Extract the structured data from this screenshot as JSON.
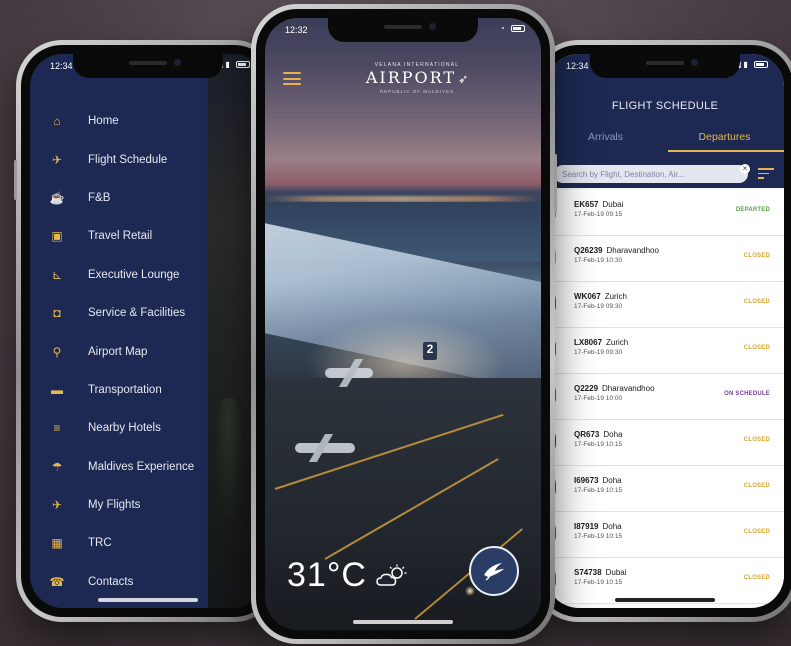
{
  "left_phone": {
    "status_time": "12:34",
    "menu": [
      {
        "label": "Home",
        "icon": "home-icon",
        "glyph": "⌂"
      },
      {
        "label": "Flight Schedule",
        "icon": "plane-icon",
        "glyph": "✈"
      },
      {
        "label": "F&B",
        "icon": "food-icon",
        "glyph": "☕"
      },
      {
        "label": "Travel Retail",
        "icon": "bag-icon",
        "glyph": "▣"
      },
      {
        "label": "Executive Lounge",
        "icon": "lounge-chair-icon",
        "glyph": "⊾"
      },
      {
        "label": "Service & Facilities",
        "icon": "service-icon",
        "glyph": "◘"
      },
      {
        "label": "Airport Map",
        "icon": "map-pin-icon",
        "glyph": "⚲"
      },
      {
        "label": "Transportation",
        "icon": "bus-icon",
        "glyph": "▬"
      },
      {
        "label": "Nearby Hotels",
        "icon": "bed-icon",
        "glyph": "≡"
      },
      {
        "label": "Maldives Experience",
        "icon": "palm-icon",
        "glyph": "☂"
      },
      {
        "label": "My Flights",
        "icon": "plane-takeoff-icon",
        "glyph": "✈"
      },
      {
        "label": "TRC",
        "icon": "calendar-icon",
        "glyph": "▦"
      },
      {
        "label": "Contacts",
        "icon": "contacts-icon",
        "glyph": "☎"
      }
    ]
  },
  "center_phone": {
    "status_time": "12:32",
    "logo": {
      "top": "VELANA INTERNATIONAL",
      "main": "AIRPORT",
      "sub": "REPUBLIC OF MALDIVES"
    },
    "gate_number": "2",
    "temperature": "31°C",
    "weather_icon": "partly-cloudy-icon"
  },
  "right_phone": {
    "status_time": "12:34",
    "title": "FLIGHT SCHEDULE",
    "tabs": [
      {
        "label": "Arrivals",
        "active": false
      },
      {
        "label": "Departures",
        "active": true
      }
    ],
    "search_placeholder": "Search by Flight, Destination, Air...",
    "flights": [
      {
        "flight": "EK657",
        "dest": "Dubai",
        "date": "17-Feb-19 09:15",
        "status": "DEPARTED",
        "status_color": "green",
        "tail": "#5aa14a"
      },
      {
        "flight": "Q26239",
        "dest": "Dharavandhoo",
        "date": "17-Feb-19 10:30",
        "status": "CLOSED",
        "status_color": "gold",
        "tail": "#d9a62e"
      },
      {
        "flight": "WK067",
        "dest": "Zurich",
        "date": "17-Feb-19 09:30",
        "status": "CLOSED",
        "status_color": "gold",
        "tail": "#c0392b"
      },
      {
        "flight": "LX8067",
        "dest": "Zurich",
        "date": "17-Feb-19 09:30",
        "status": "CLOSED",
        "status_color": "gold",
        "tail": "#c0392b"
      },
      {
        "flight": "Q2229",
        "dest": "Dharavandhoo",
        "date": "17-Feb-19 10:00",
        "status": "ON SCHEDULE",
        "status_color": "purple",
        "tail": "#2a6fb0"
      },
      {
        "flight": "QR673",
        "dest": "Doha",
        "date": "17-Feb-19 10:15",
        "status": "CLOSED",
        "status_color": "gold",
        "tail": "#7a1f3d"
      },
      {
        "flight": "I69673",
        "dest": "Doha",
        "date": "17-Feb-19 10:15",
        "status": "CLOSED",
        "status_color": "gold",
        "tail": "#b02a2a"
      },
      {
        "flight": "I87919",
        "dest": "Doha",
        "date": "17-Feb-19 10:15",
        "status": "CLOSED",
        "status_color": "gold",
        "tail": "#c0392b"
      },
      {
        "flight": "S74738",
        "dest": "Dubai",
        "date": "17-Feb-19 10:15",
        "status": "CLOSED",
        "status_color": "gold",
        "tail": "#3a8a3a"
      }
    ]
  },
  "colors": {
    "navy": "#1d2952",
    "gold": "#e5b551",
    "status_green": "#5aa14a",
    "status_purple": "#7a3d9a"
  }
}
